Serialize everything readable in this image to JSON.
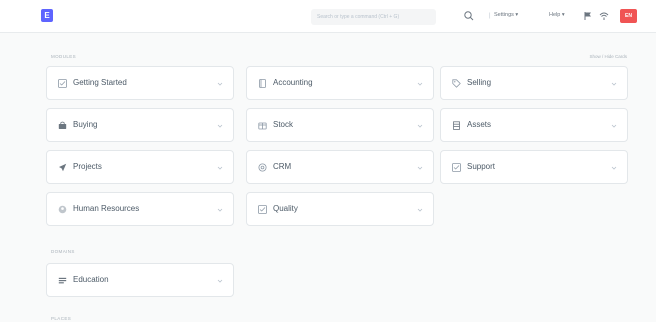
{
  "navbar": {
    "logo_letter": "E",
    "search_placeholder": "Search or type a command (Ctrl + G)",
    "settings_label": "Settings",
    "help_label": "Help",
    "avatar_initials": "EN"
  },
  "modules_section": {
    "heading": "Modules",
    "show_hide_label": "Show / Hide Cards",
    "cards": [
      {
        "label": "Getting Started",
        "icon": "checklist-icon"
      },
      {
        "label": "Accounting",
        "icon": "book-icon"
      },
      {
        "label": "Selling",
        "icon": "tag-icon"
      },
      {
        "label": "Buying",
        "icon": "shopping-icon"
      },
      {
        "label": "Stock",
        "icon": "box-icon"
      },
      {
        "label": "Assets",
        "icon": "building-icon"
      },
      {
        "label": "Projects",
        "icon": "rocket-icon"
      },
      {
        "label": "CRM",
        "icon": "crm-icon"
      },
      {
        "label": "Support",
        "icon": "support-icon"
      },
      {
        "label": "Human Resources",
        "icon": "people-icon"
      },
      {
        "label": "Quality",
        "icon": "quality-icon"
      }
    ]
  },
  "domains_section": {
    "heading": "Domains",
    "cards": [
      {
        "label": "Education",
        "icon": "education-icon"
      }
    ]
  },
  "places_section": {
    "heading": "Places"
  },
  "colors": {
    "accent": "#5e64ff",
    "avatar_bg": "#f05454"
  }
}
